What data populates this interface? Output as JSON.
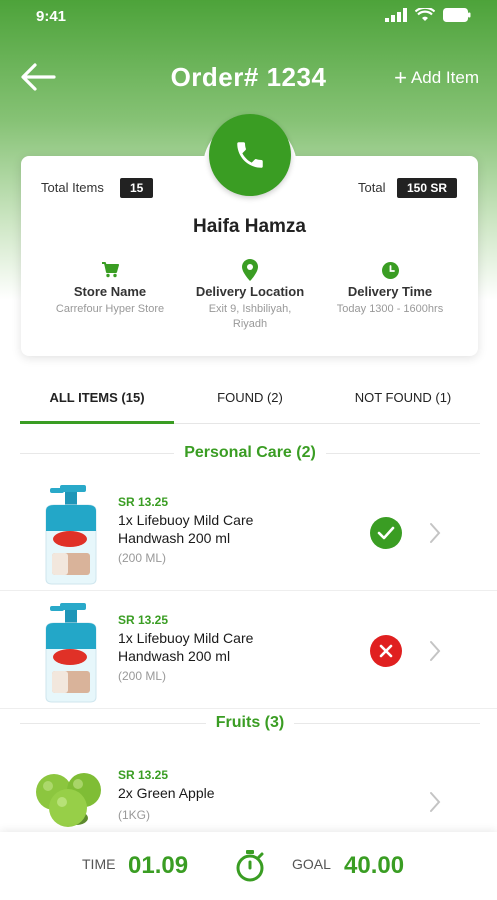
{
  "status_bar": {
    "time": "9:41"
  },
  "nav": {
    "title": "Order# 1234",
    "add_item_label": "Add Item",
    "add_item_icon": "plus-icon"
  },
  "summary": {
    "total_items_label": "Total Items",
    "total_items_value": "15",
    "total_label": "Total",
    "total_value": "150 SR",
    "customer_name": "Haifa Hamza",
    "store": {
      "icon": "cart-icon",
      "title": "Store Name",
      "value": "Carrefour Hyper Store"
    },
    "delivery_location": {
      "icon": "location-pin-icon",
      "title": "Delivery Location",
      "value": "Exit 9, Ishbiliyah, Riyadh"
    },
    "delivery_time": {
      "icon": "clock-icon",
      "title": "Delivery Time",
      "value": "Today 1300 - 1600hrs"
    }
  },
  "tabs": [
    {
      "label": "ALL ITEMS (15)",
      "active": true
    },
    {
      "label": "FOUND (2)",
      "active": false
    },
    {
      "label": "NOT FOUND (1)",
      "active": false
    }
  ],
  "sections": [
    {
      "title": "Personal Care (2)",
      "items": [
        {
          "price": "SR 13.25",
          "name": "1x Lifebuoy Mild Care Handwash 200 ml",
          "size": "(200 ML)",
          "status": "found"
        },
        {
          "price": "SR 13.25",
          "name": "1x Lifebuoy Mild Care Handwash 200 ml",
          "size": "(200 ML)",
          "status": "not-found"
        }
      ]
    },
    {
      "title": "Fruits (3)",
      "items": [
        {
          "price": "SR 13.25",
          "name": "2x Green Apple",
          "size": "(1KG)",
          "status": "none"
        }
      ]
    }
  ],
  "bottom_bar": {
    "time_label": "TIME",
    "time_value": "01.09",
    "goal_label": "GOAL",
    "goal_value": "40.00",
    "icon": "stopwatch-icon"
  },
  "colors": {
    "accent": "#3a9d23",
    "not_found": "#e02020",
    "dark_badge": "#222222"
  }
}
